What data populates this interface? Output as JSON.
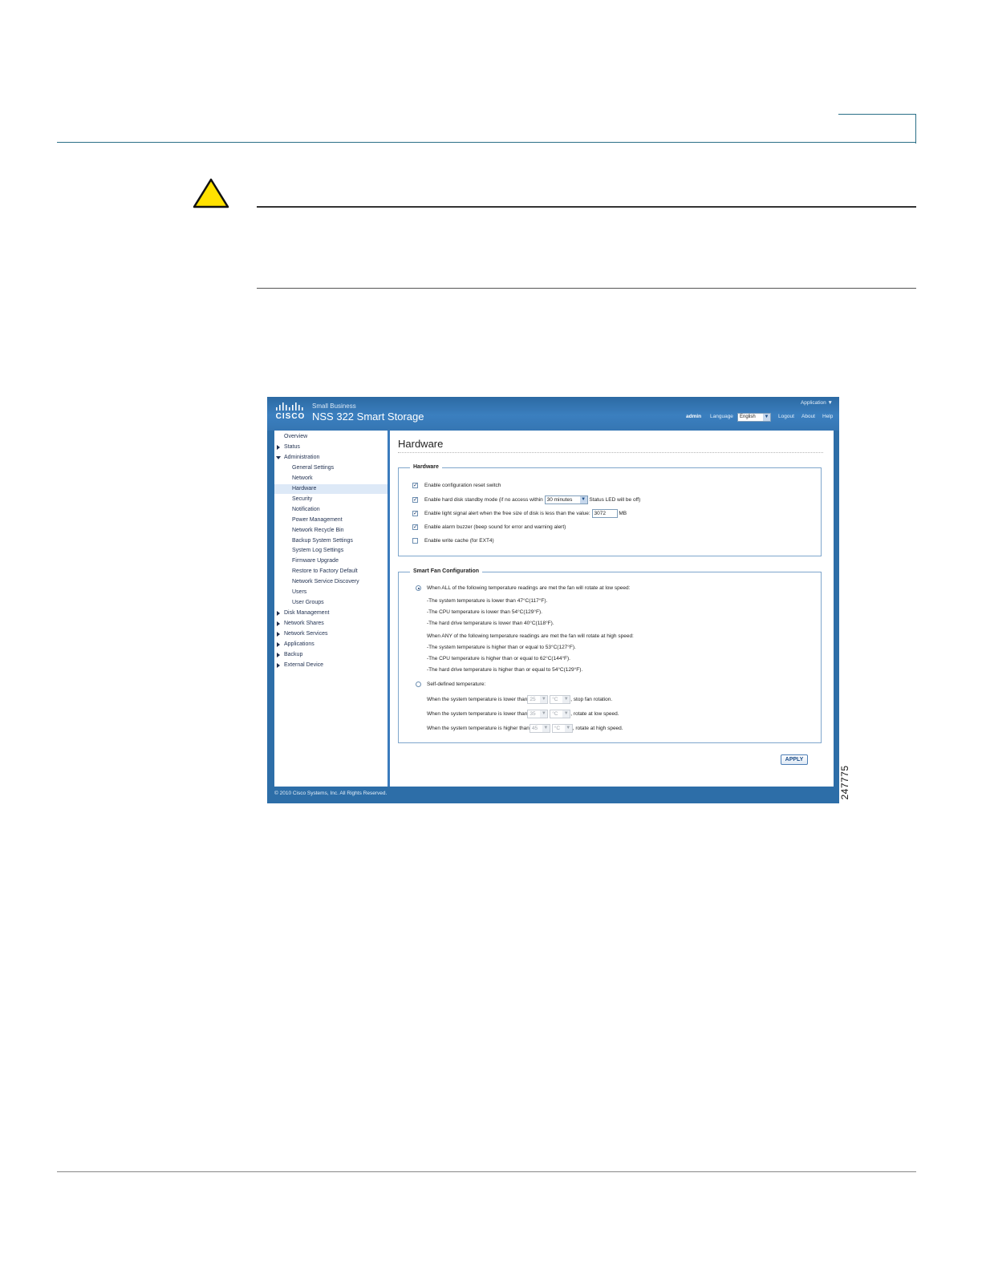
{
  "figure_id": "247775",
  "app": {
    "brand_small": "Small Business",
    "brand_word": "CISCO",
    "title": "NSS 322 Smart Storage",
    "application_menu": "Application ▼",
    "user": "admin",
    "language_label": "Language",
    "language_value": "English",
    "links": {
      "logout": "Logout",
      "about": "About",
      "help": "Help"
    },
    "footer": "© 2010 Cisco Systems, Inc. All Rights Reserved."
  },
  "sidebar": {
    "items": [
      {
        "label": "Overview",
        "level": 0,
        "expand": "none"
      },
      {
        "label": "Status",
        "level": 0,
        "expand": "collapsed"
      },
      {
        "label": "Administration",
        "level": 0,
        "expand": "expanded"
      },
      {
        "label": "General Settings",
        "level": 1,
        "expand": "none"
      },
      {
        "label": "Network",
        "level": 1,
        "expand": "none"
      },
      {
        "label": "Hardware",
        "level": 1,
        "expand": "none",
        "active": true
      },
      {
        "label": "Security",
        "level": 1,
        "expand": "none"
      },
      {
        "label": "Notification",
        "level": 1,
        "expand": "none"
      },
      {
        "label": "Power Management",
        "level": 1,
        "expand": "none"
      },
      {
        "label": "Network Recycle Bin",
        "level": 1,
        "expand": "none"
      },
      {
        "label": "Backup System Settings",
        "level": 1,
        "expand": "none"
      },
      {
        "label": "System Log Settings",
        "level": 1,
        "expand": "none"
      },
      {
        "label": "Firmware Upgrade",
        "level": 1,
        "expand": "none"
      },
      {
        "label": "Restore to Factory Default",
        "level": 1,
        "expand": "none"
      },
      {
        "label": "Network Service Discovery",
        "level": 1,
        "expand": "none"
      },
      {
        "label": "Users",
        "level": 1,
        "expand": "none"
      },
      {
        "label": "User Groups",
        "level": 1,
        "expand": "none"
      },
      {
        "label": "Disk Management",
        "level": 0,
        "expand": "collapsed"
      },
      {
        "label": "Network Shares",
        "level": 0,
        "expand": "collapsed"
      },
      {
        "label": "Network Services",
        "level": 0,
        "expand": "collapsed"
      },
      {
        "label": "Applications",
        "level": 0,
        "expand": "collapsed"
      },
      {
        "label": "Backup",
        "level": 0,
        "expand": "collapsed"
      },
      {
        "label": "External Device",
        "level": 0,
        "expand": "collapsed"
      }
    ]
  },
  "main": {
    "title": "Hardware",
    "hardware": {
      "legend": "Hardware",
      "reset_switch": {
        "label": "Enable configuration reset switch",
        "checked": true
      },
      "standby": {
        "prefix": "Enable hard disk standby mode (if no access within",
        "value": "30 minutes",
        "suffix": "Status LED will be off)",
        "checked": true
      },
      "light_alert": {
        "prefix": "Enable light signal alert when the free size of disk is less than the value:",
        "value": "3072",
        "unit": "MB",
        "checked": true
      },
      "buzzer": {
        "label": "Enable alarm buzzer (beep sound for error and warning alert)",
        "checked": true
      },
      "write_cache": {
        "label": "Enable write cache (for EXT4)",
        "checked": false
      }
    },
    "fan": {
      "legend": "Smart Fan Configuration",
      "auto_label": "When ALL of the following temperature readings are met the fan will rotate at low speed:",
      "auto_selected": true,
      "low_lines": [
        "-The system temperature is lower than 47°C(117°F).",
        "-The CPU temperature is lower than 54°C(129°F).",
        "-The hard drive temperature is lower than 40°C(118°F)."
      ],
      "high_intro": "When ANY of the following temperature readings are met the fan will rotate at high speed:",
      "high_lines": [
        "-The system temperature is higher than or equal to 53°C(127°F).",
        "-The CPU temperature is higher than or equal to 62°C(144°F).",
        "-The hard drive temperature is higher than or equal to 54°C(129°F)."
      ],
      "self_label": "Self-defined temperature:",
      "self_selected": false,
      "self_rows": [
        {
          "prefix": "When the system temperature is lower than",
          "value": "25",
          "unit": "°C",
          "suffix": ", stop fan rotation."
        },
        {
          "prefix": "When the system temperature is lower than",
          "value": "35",
          "unit": "°C",
          "suffix": ", rotate at low speed."
        },
        {
          "prefix": "When the system temperature is higher than",
          "value": "45",
          "unit": "°C",
          "suffix": ", rotate at high speed."
        }
      ]
    },
    "apply_label": "APPLY"
  },
  "colors": {
    "banner": "#3576b3",
    "caution_fill": "#ffe100",
    "rule": "#2a6f87"
  }
}
